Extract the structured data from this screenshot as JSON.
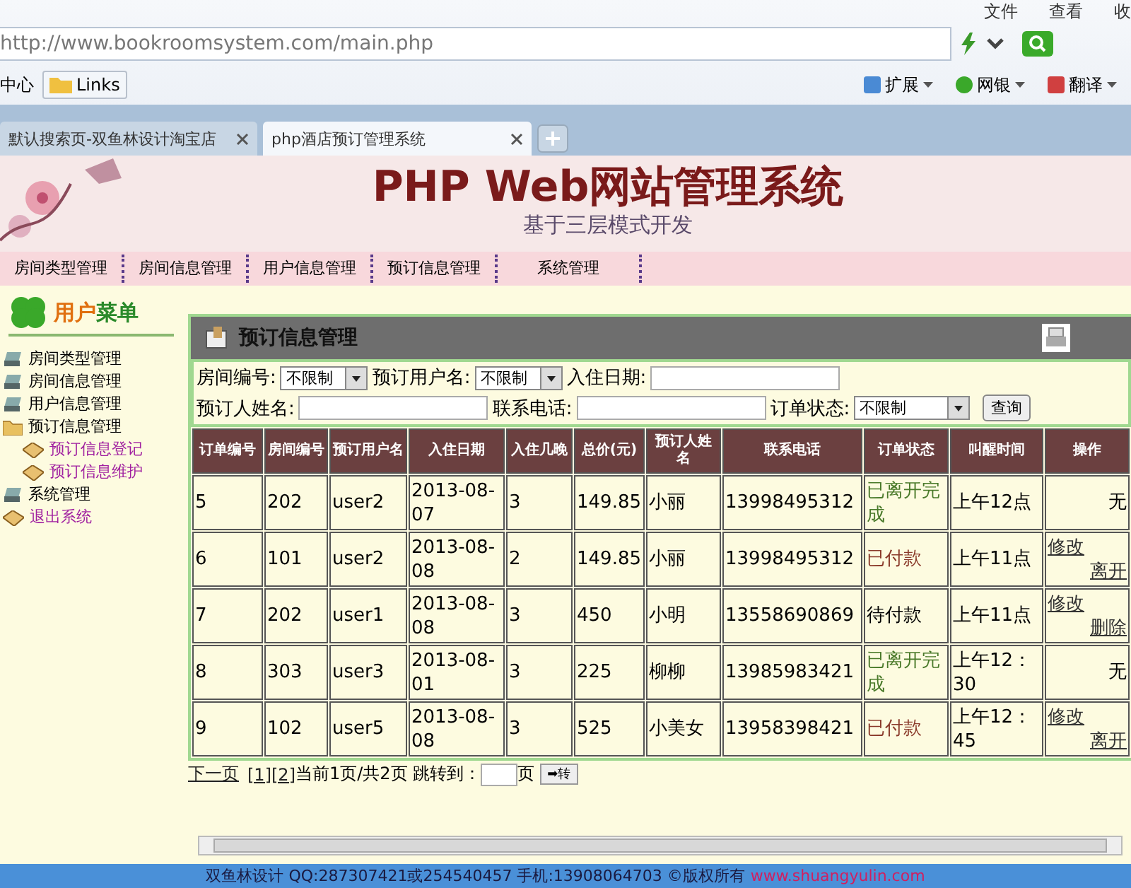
{
  "browser": {
    "menu": [
      "文件",
      "查看",
      "收"
    ],
    "address": "http://www.bookroomsystem.com/main.php",
    "bookmarks": [
      "中心",
      "Links"
    ],
    "tools": [
      "扩展",
      "网银",
      "翻译"
    ],
    "tabs": [
      {
        "label": "默认搜索页-双鱼林设计淘宝店",
        "selected": false
      },
      {
        "label": "php酒店预订管理系统",
        "selected": true
      }
    ]
  },
  "banner": {
    "title": "PHP Web网站管理系统",
    "subtitle": "基于三层模式开发"
  },
  "nav": [
    "房间类型管理",
    "房间信息管理",
    "用户信息管理",
    "预订信息管理",
    "系统管理"
  ],
  "sidebar": {
    "title": [
      {
        "text": "用户",
        "color": "#e07010"
      },
      {
        "text": "菜单",
        "color": "#2a8a2a"
      }
    ],
    "items": [
      {
        "label": "房间类型管理",
        "kind": "drive",
        "link": false
      },
      {
        "label": "房间信息管理",
        "kind": "drive",
        "link": false
      },
      {
        "label": "用户信息管理",
        "kind": "drive",
        "link": false
      },
      {
        "label": "预订信息管理",
        "kind": "folder",
        "link": false,
        "children": [
          {
            "label": "预订信息登记",
            "kind": "book",
            "link": true
          },
          {
            "label": "预订信息维护",
            "kind": "book",
            "link": true
          }
        ]
      },
      {
        "label": "系统管理",
        "kind": "drive",
        "link": false
      },
      {
        "label": "退出系统",
        "kind": "book",
        "link": true
      }
    ]
  },
  "panel": {
    "title": "预订信息管理"
  },
  "filters": [
    [
      {
        "label": "房间编号:",
        "kind": "select",
        "value": "不限制"
      },
      {
        "label": "预订用户名:",
        "kind": "select",
        "value": "不限制"
      },
      {
        "label": "入住日期:",
        "kind": "input"
      }
    ],
    [
      {
        "label": "预订人姓名:",
        "kind": "input"
      },
      {
        "label": "联系电话:",
        "kind": "input"
      },
      {
        "label": "订单状态:",
        "kind": "select",
        "value": "不限制"
      }
    ]
  ],
  "search_button": "查询",
  "table": {
    "columns": [
      "订单编号",
      "房间编号",
      "预订用户名",
      "入住日期",
      "入住几晚",
      "总价(元)",
      "预订人姓名",
      "联系电话",
      "订单状态",
      "叫醒时间",
      "操作"
    ],
    "rows": [
      {
        "cells": [
          "5",
          "202",
          "user2",
          "2013-08-07",
          "3",
          "149.85",
          "小丽",
          "13998495312"
        ],
        "status": {
          "text": "已离开完成",
          "color": "#4a7a2a"
        },
        "wake": "上午12点",
        "actions": [
          {
            "text": "无",
            "kind": "text"
          }
        ]
      },
      {
        "cells": [
          "6",
          "101",
          "user2",
          "2013-08-08",
          "2",
          "149.85",
          "小丽",
          "13998495312"
        ],
        "status": {
          "text": "已付款",
          "color": "#8a3a2a"
        },
        "wake": "上午11点",
        "actions": [
          {
            "text": "修改",
            "kind": "link"
          },
          {
            "text": "离开",
            "kind": "link"
          }
        ]
      },
      {
        "cells": [
          "7",
          "202",
          "user1",
          "2013-08-08",
          "3",
          "450",
          "小明",
          "13558690869"
        ],
        "status": {
          "text": "待付款",
          "color": "#000000"
        },
        "wake": "上午11点",
        "actions": [
          {
            "text": "修改",
            "kind": "link"
          },
          {
            "text": "删除",
            "kind": "link"
          }
        ]
      },
      {
        "cells": [
          "8",
          "303",
          "user3",
          "2013-08-01",
          "3",
          "225",
          "柳柳",
          "13985983421"
        ],
        "status": {
          "text": "已离开完成",
          "color": "#4a7a2a"
        },
        "wake": "上午12：30",
        "actions": [
          {
            "text": "无",
            "kind": "text"
          }
        ]
      },
      {
        "cells": [
          "9",
          "102",
          "user5",
          "2013-08-08",
          "3",
          "525",
          "小美女",
          "13958398421"
        ],
        "status": {
          "text": "已付款",
          "color": "#8a3a2a"
        },
        "wake": "上午12：45",
        "actions": [
          {
            "text": "修改",
            "kind": "link"
          },
          {
            "text": "离开",
            "kind": "link"
          }
        ]
      }
    ]
  },
  "pager": {
    "next": "下一页",
    "pages": [
      "[1]",
      "[2]"
    ],
    "info": "当前1页/共2页 跳转到：",
    "unit": "页",
    "go": "➡转"
  },
  "footer": {
    "text": "双鱼林设计 QQ:287307421或254540457 手机:13908064703 ©版权所有",
    "link": "www.shuangyulin.com"
  }
}
